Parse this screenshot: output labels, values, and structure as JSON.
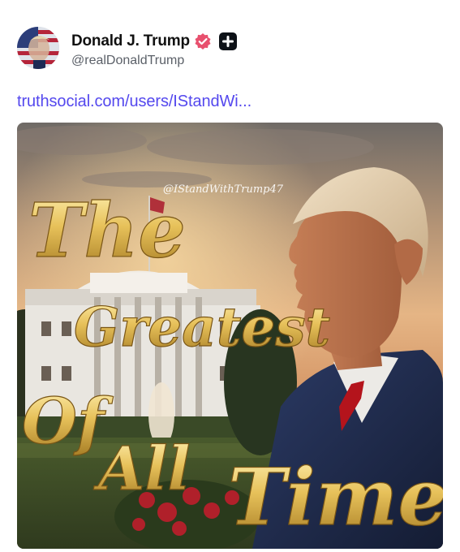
{
  "post": {
    "author": {
      "display_name": "Donald J. Trump",
      "handle": "@realDonaldTrump",
      "verified_icon": "verified-badge-icon",
      "verified_color": "#e8506e",
      "plus_icon": "plus-badge-icon"
    },
    "link_text": "truthsocial.com/users/IStandWi...",
    "media": {
      "watermark": "@IStandWithTrump47",
      "headline_lines": [
        "The",
        "Greatest",
        "Of",
        "All",
        "Time"
      ],
      "gold_color": "#e7c15a"
    }
  },
  "colors": {
    "accent_link": "#5448ee",
    "text_primary": "#111111",
    "text_secondary": "#5b6068"
  }
}
